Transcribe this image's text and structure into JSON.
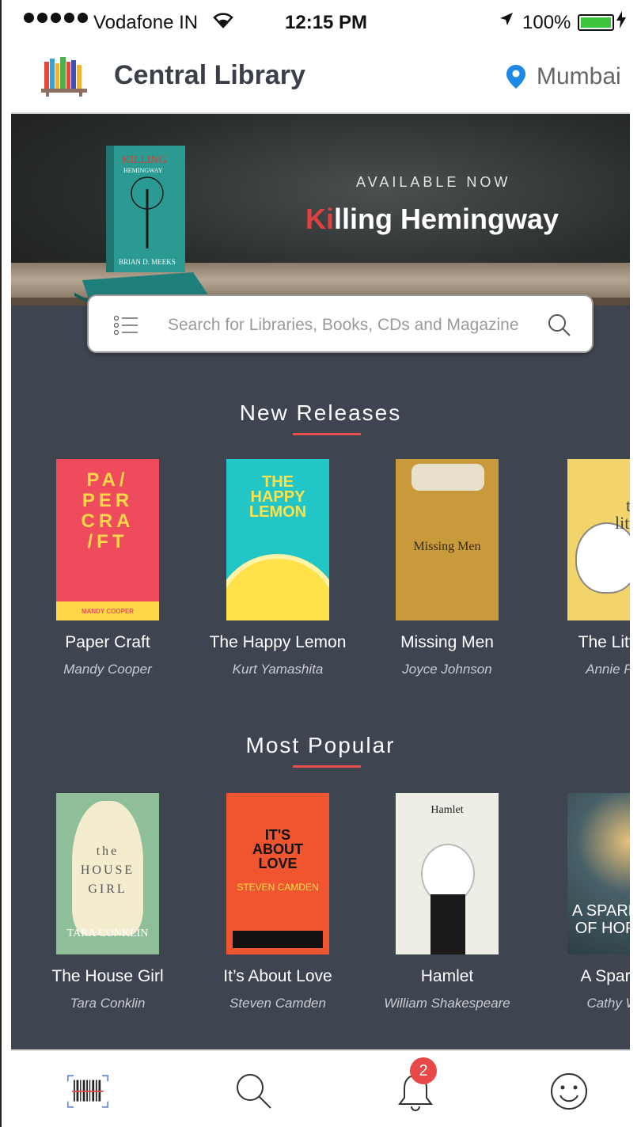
{
  "status_bar": {
    "carrier": "Vodafone IN",
    "time": "12:15 PM",
    "battery_percent": "100%",
    "battery_level": 1.0
  },
  "header": {
    "title": "Central Library",
    "location": "Mumbai"
  },
  "banner": {
    "tagline": "AVAILABLE NOW",
    "book_title_highlight": "Ki",
    "book_title_rest": "lling Hemingway"
  },
  "search": {
    "placeholder": "Search for Libraries, Books, CDs and Magazine"
  },
  "new_releases": {
    "title": "New Releases",
    "books": [
      {
        "title": "Paper Craft",
        "author": "Mandy Cooper",
        "cover_text": "PA/\nPER\nCRA\n/FT",
        "cover_author": "MANDY COOPER"
      },
      {
        "title": "The Happy Lemon",
        "author": "Kurt Yamashita",
        "cover_text": "THE\nHAPPY\nLEMON"
      },
      {
        "title": "Missing Men",
        "author": "Joyce Johnson",
        "cover_text": "Missing Men"
      },
      {
        "title": "The Littlest",
        "author": "Annie F Gil",
        "cover_text": "the\nlittlest\nbi"
      }
    ]
  },
  "most_popular": {
    "title": "Most Popular",
    "books": [
      {
        "title": "The House Girl",
        "author": "Tara Conklin",
        "cover_text": "the\nHOUSE\nGIRL",
        "cover_author": "TARA CONKLIN"
      },
      {
        "title": "It’s About Love",
        "author": "Steven Camden",
        "cover_text": "IT'S\nABOUT\nLOVE",
        "cover_author": "STEVEN CAMDEN"
      },
      {
        "title": "Hamlet",
        "author": "William Shakespeare",
        "cover_text": "Hamlet"
      },
      {
        "title": "A Spark of ",
        "author": "Cathy Wilk",
        "cover_text": "A SPARK\nOF HOP"
      }
    ]
  },
  "bottom_nav": {
    "notifications_count": "2"
  }
}
